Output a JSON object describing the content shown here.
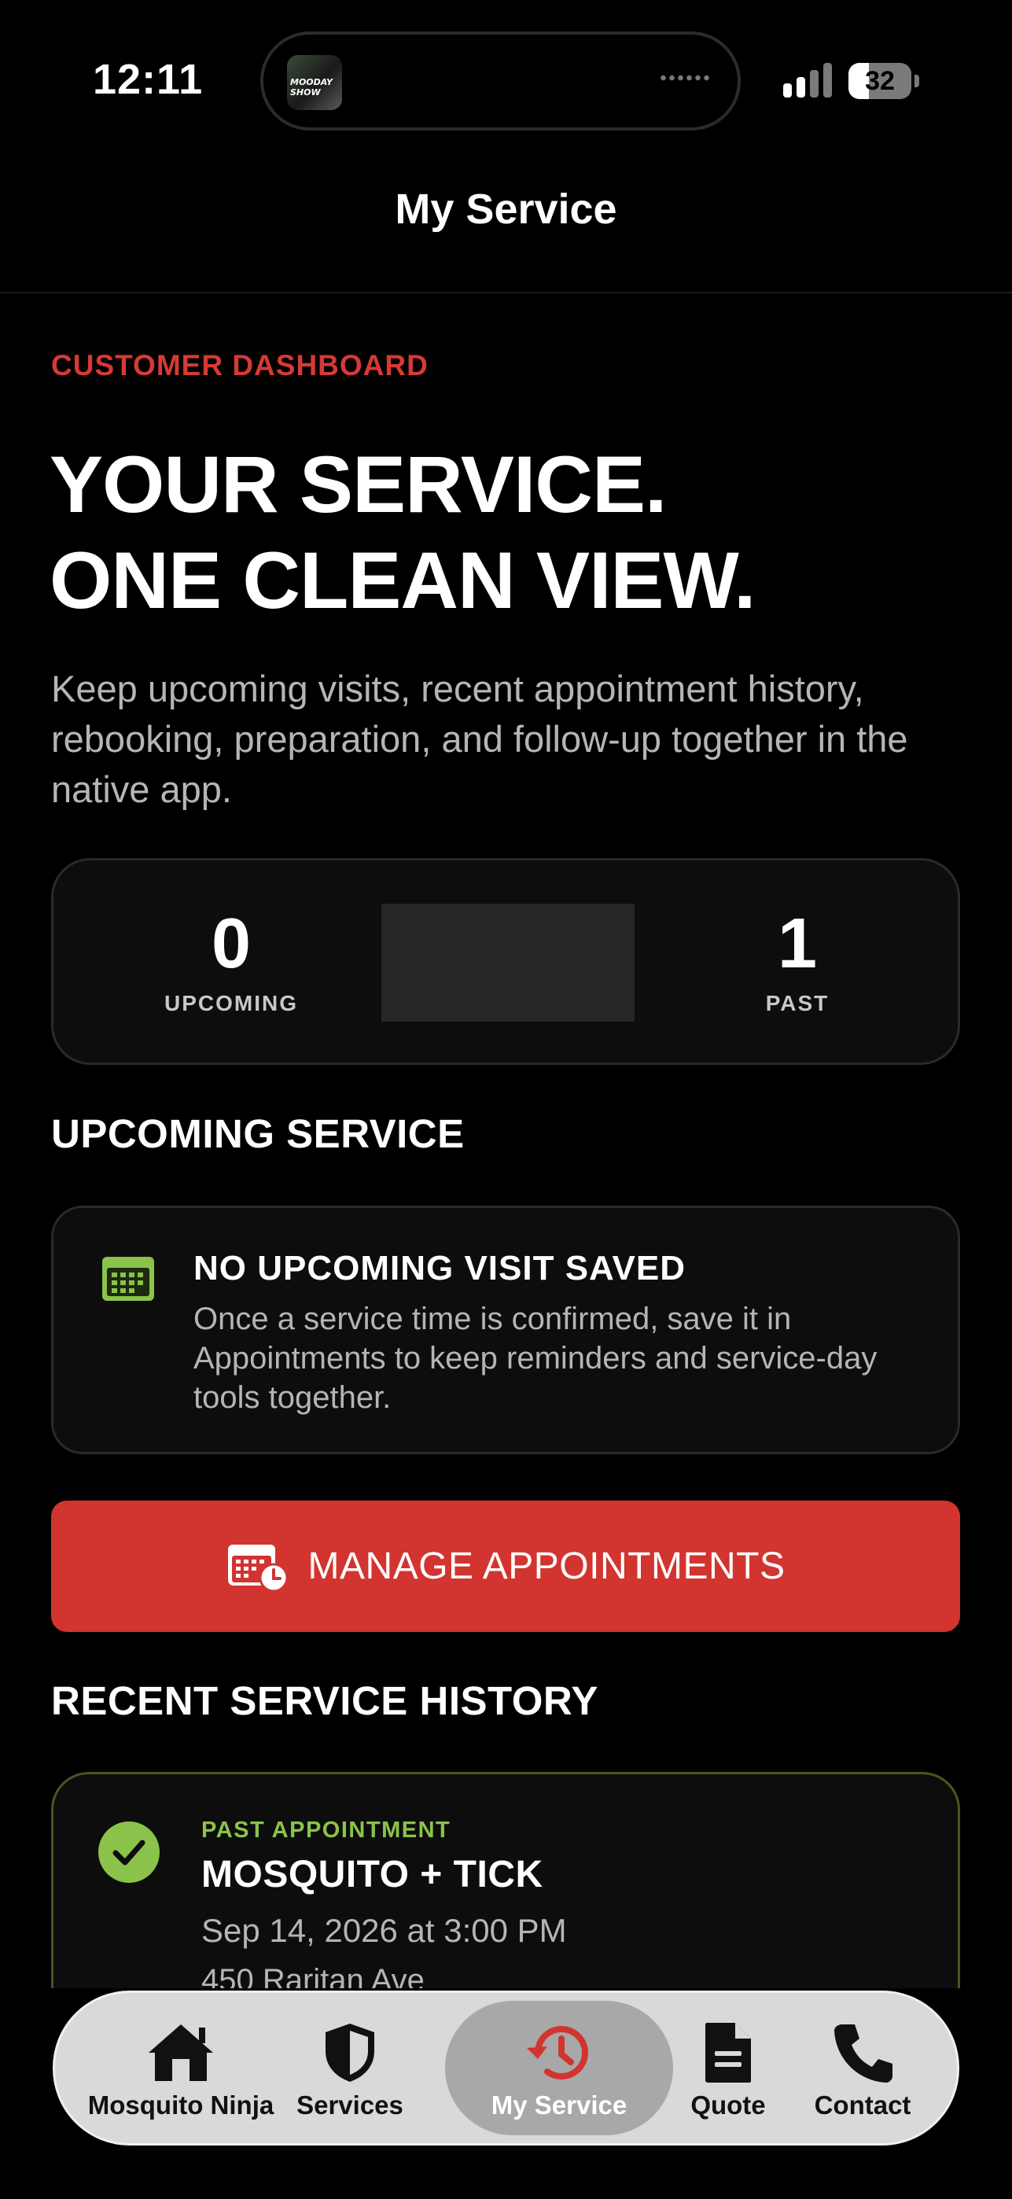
{
  "status_bar": {
    "time": "12:11",
    "battery": "32",
    "battery_level": 0.32,
    "now_playing_art": "MOODAY SHOW"
  },
  "header": {
    "title": "My Service"
  },
  "hero": {
    "eyebrow": "CUSTOMER DASHBOARD",
    "headline_line1": "YOUR SERVICE.",
    "headline_line2": "ONE CLEAN VIEW.",
    "intro": "Keep upcoming visits, recent appointment history, rebooking, preparation, and follow-up together in the native app."
  },
  "stats": {
    "upcoming": {
      "value": "0",
      "label": "UPCOMING"
    },
    "past": {
      "value": "1",
      "label": "PAST"
    }
  },
  "upcoming_section": {
    "title": "UPCOMING SERVICE",
    "empty_title": "NO UPCOMING VISIT SAVED",
    "empty_text": "Once a service time is confirmed, save it in Appointments to keep reminders and service-day tools together.",
    "icon": "calendar-icon"
  },
  "cta": {
    "label": "MANAGE APPOINTMENTS",
    "icon": "calendar-clock-icon"
  },
  "history_section": {
    "title": "RECENT SERVICE HISTORY",
    "items": [
      {
        "status": "PAST APPOINTMENT",
        "title": "MOSQUITO + TICK",
        "date": "Sep 14, 2026 at 3:00 PM",
        "address": "450 Raritan Ave",
        "icon": "checkmark-circle-icon"
      }
    ]
  },
  "tab_bar": {
    "tabs": [
      {
        "label": "Mosquito Ninja",
        "icon": "house-icon"
      },
      {
        "label": "Services",
        "icon": "shield-icon"
      },
      {
        "label": "My Service",
        "icon": "history-clock-icon",
        "active": true
      },
      {
        "label": "Quote",
        "icon": "document-icon"
      },
      {
        "label": "Contact",
        "icon": "phone-icon"
      }
    ]
  },
  "colors": {
    "background": "#000000",
    "accent_red": "#d23430",
    "eyebrow_red": "#d63a35",
    "accent_green": "#8bc34a",
    "card": "#0d0d0d",
    "muted_text": "#b5b5b5"
  }
}
